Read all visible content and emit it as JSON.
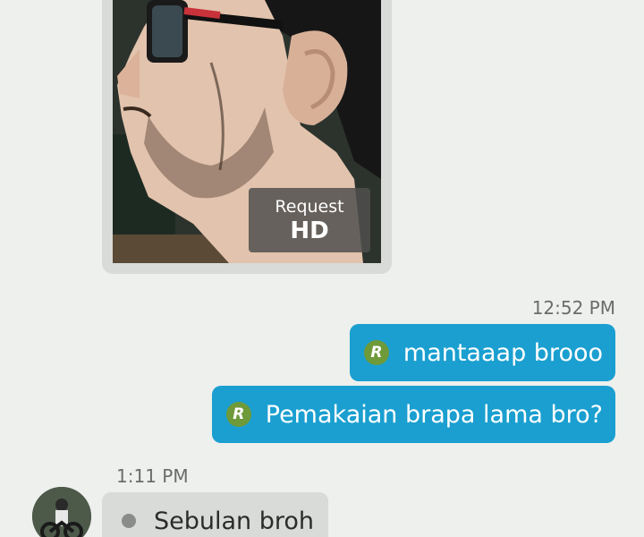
{
  "photo_message": {
    "hd_button": {
      "line1": "Request",
      "line2": "HD"
    }
  },
  "outgoing": {
    "timestamp": "12:52 PM",
    "messages": [
      {
        "read_marker": "R",
        "text": "mantaaap brooo"
      },
      {
        "read_marker": "R",
        "text": "Pemakaian brapa lama bro?"
      }
    ],
    "bubble_color": "#1a9fd0",
    "read_marker_color": "#6f9a3a"
  },
  "incoming": {
    "timestamp": "1:11 PM",
    "messages": [
      {
        "text": "Sebulan broh"
      }
    ],
    "bubble_color": "#d9dbd8"
  }
}
